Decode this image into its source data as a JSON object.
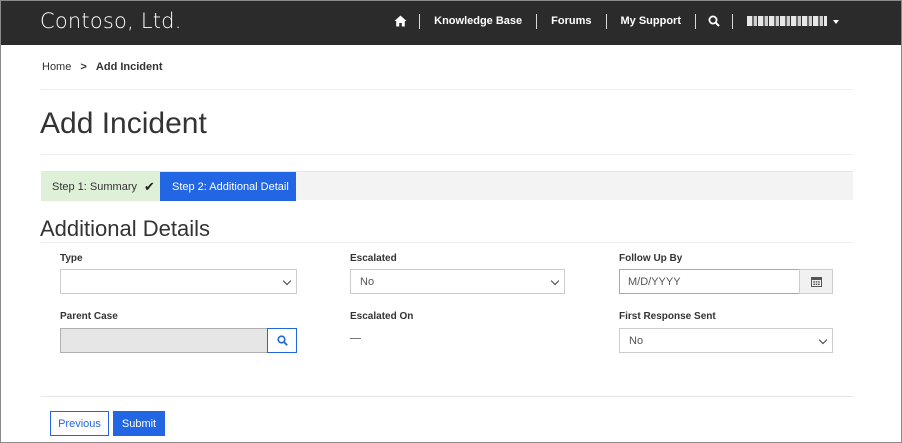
{
  "header": {
    "brand": "Contoso, Ltd.",
    "nav": {
      "home_icon": "home-icon",
      "knowledge_base": "Knowledge Base",
      "forums": "Forums",
      "my_support": "My Support",
      "search_icon": "search-icon"
    }
  },
  "breadcrumb": {
    "home": "Home",
    "separator": ">",
    "current": "Add Incident"
  },
  "page_title": "Add Incident",
  "steps": {
    "step1": "Step 1: Summary",
    "step2": "Step 2: Additional Detail"
  },
  "section_title": "Additional Details",
  "form": {
    "type": {
      "label": "Type",
      "value": ""
    },
    "escalated": {
      "label": "Escalated",
      "value": "No"
    },
    "follow_up_by": {
      "label": "Follow Up By",
      "placeholder": "M/D/YYYY"
    },
    "parent_case": {
      "label": "Parent Case",
      "value": ""
    },
    "escalated_on": {
      "label": "Escalated On"
    },
    "first_response_sent": {
      "label": "First Response Sent",
      "value": "No"
    }
  },
  "buttons": {
    "previous": "Previous",
    "submit": "Submit"
  },
  "colors": {
    "header_bg": "#2b2b2b",
    "primary": "#2266e3",
    "step_done_bg": "#dff0d8"
  }
}
